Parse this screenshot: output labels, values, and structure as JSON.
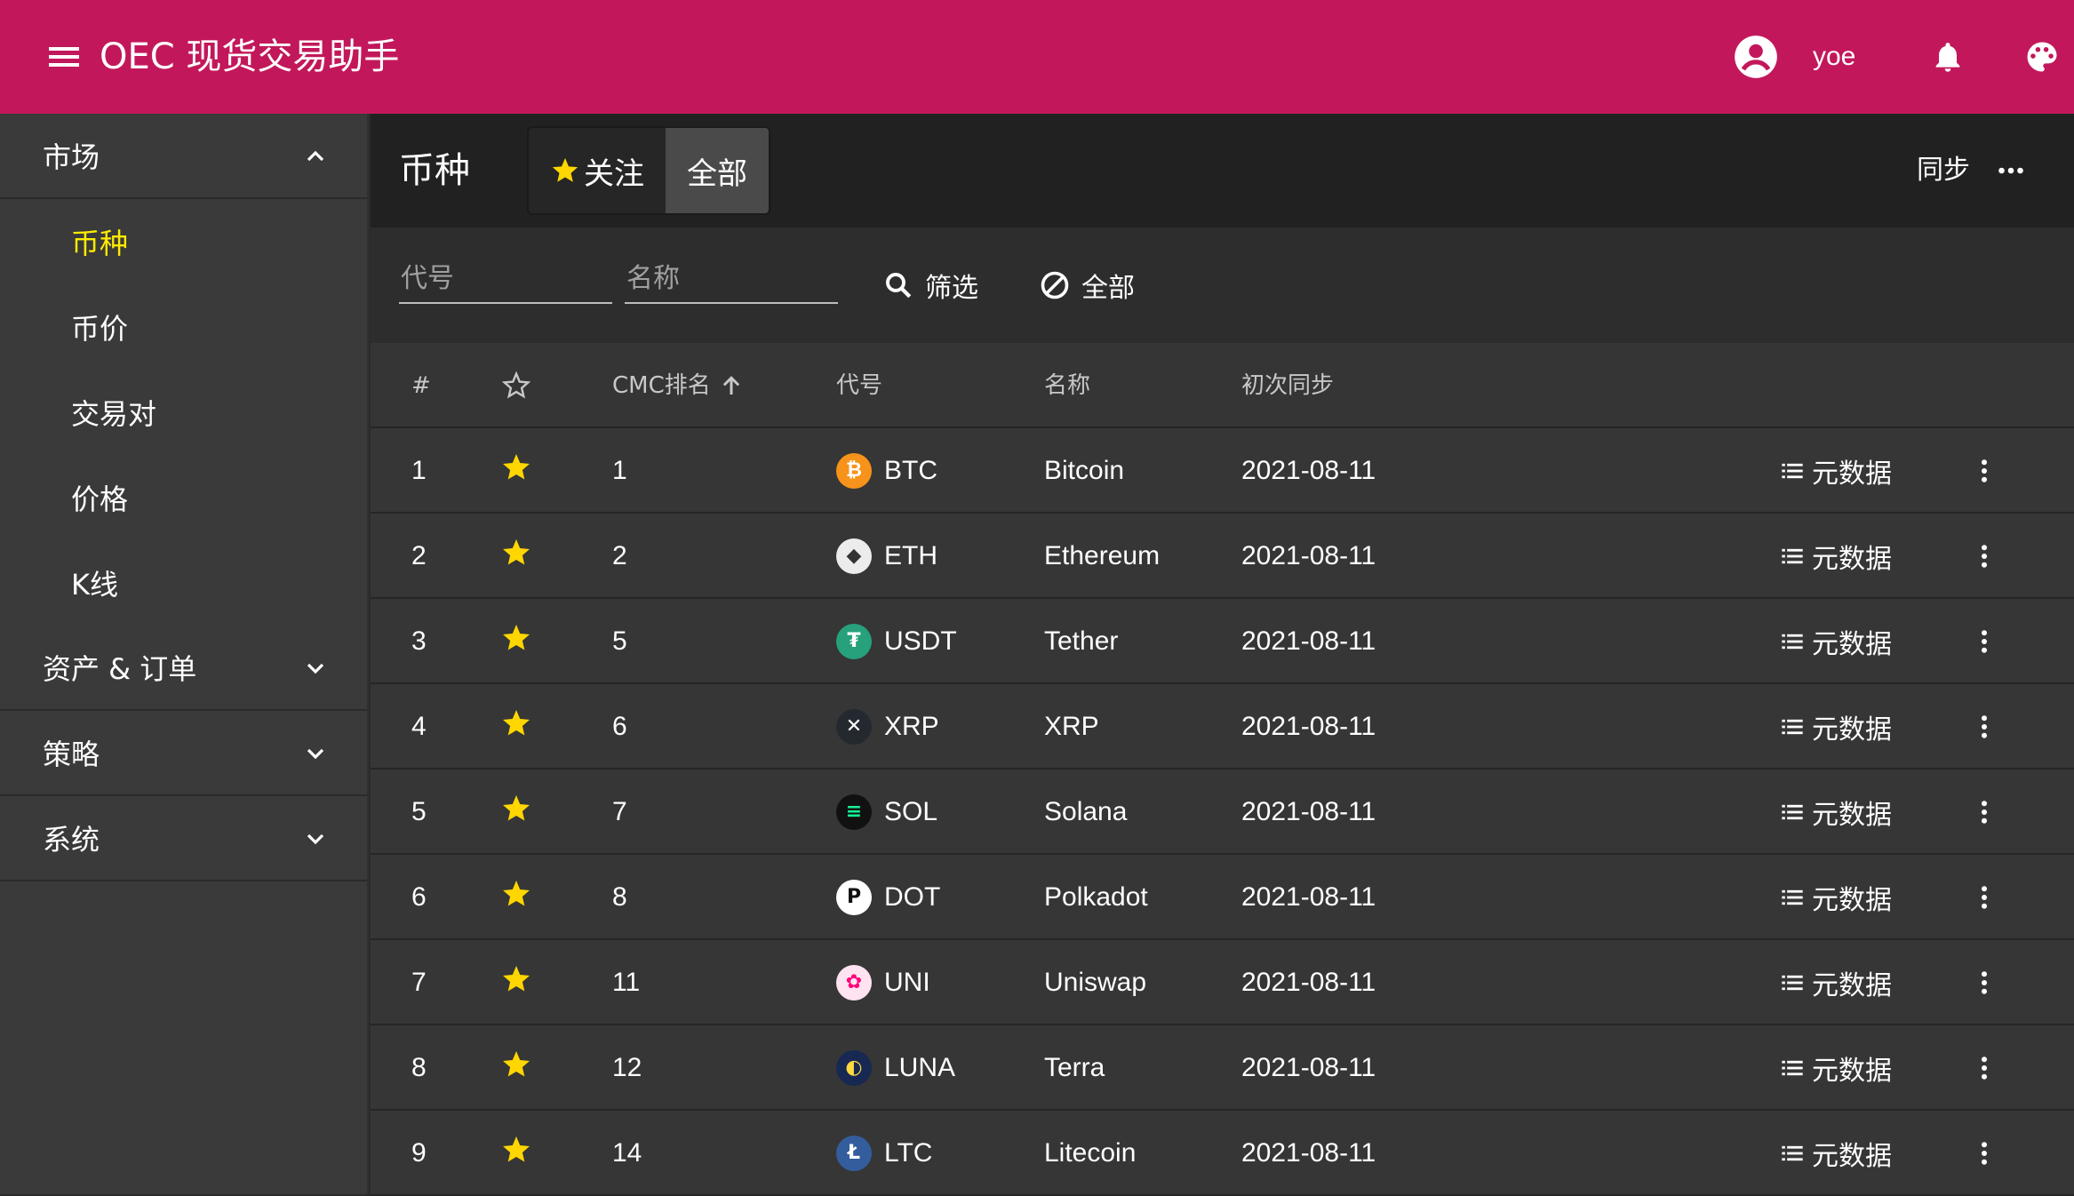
{
  "app": {
    "title": "OEC 现货交易助手",
    "username": "yoe",
    "colors": {
      "appbar": "#c2185b",
      "active_nav": "#ffeb00",
      "star": "#ffd600"
    }
  },
  "sidebar": {
    "groups": [
      {
        "label": "市场",
        "expanded": true,
        "items": [
          {
            "label": "币种",
            "active": true
          },
          {
            "label": "币价"
          },
          {
            "label": "交易对"
          },
          {
            "label": "价格"
          },
          {
            "label": "K线"
          }
        ]
      },
      {
        "label": "资产 & 订单",
        "expanded": false
      },
      {
        "label": "策略",
        "expanded": false
      },
      {
        "label": "系统",
        "expanded": false
      }
    ]
  },
  "toolbar": {
    "title": "币种",
    "toggle_follow": "关注",
    "toggle_all": "全部",
    "sync": "同步"
  },
  "filters": {
    "code_placeholder": "代号",
    "name_placeholder": "名称",
    "filter_label": "筛选",
    "all_label": "全部"
  },
  "table": {
    "headers": {
      "index": "#",
      "cmc_rank": "CMC排名",
      "code": "代号",
      "name": "名称",
      "first_sync": "初次同步"
    },
    "meta_label": "元数据",
    "rows": [
      {
        "index": "1",
        "rank": "1",
        "code": "BTC",
        "name": "Bitcoin",
        "date": "2021-08-11",
        "icon": "btc-icon"
      },
      {
        "index": "2",
        "rank": "2",
        "code": "ETH",
        "name": "Ethereum",
        "date": "2021-08-11",
        "icon": "eth-icon"
      },
      {
        "index": "3",
        "rank": "5",
        "code": "USDT",
        "name": "Tether",
        "date": "2021-08-11",
        "icon": "usdt-icon"
      },
      {
        "index": "4",
        "rank": "6",
        "code": "XRP",
        "name": "XRP",
        "date": "2021-08-11",
        "icon": "xrp-icon"
      },
      {
        "index": "5",
        "rank": "7",
        "code": "SOL",
        "name": "Solana",
        "date": "2021-08-11",
        "icon": "sol-icon"
      },
      {
        "index": "6",
        "rank": "8",
        "code": "DOT",
        "name": "Polkadot",
        "date": "2021-08-11",
        "icon": "dot-icon"
      },
      {
        "index": "7",
        "rank": "11",
        "code": "UNI",
        "name": "Uniswap",
        "date": "2021-08-11",
        "icon": "uni-icon"
      },
      {
        "index": "8",
        "rank": "12",
        "code": "LUNA",
        "name": "Terra",
        "date": "2021-08-11",
        "icon": "luna-icon"
      },
      {
        "index": "9",
        "rank": "14",
        "code": "LTC",
        "name": "Litecoin",
        "date": "2021-08-11",
        "icon": "ltc-icon"
      }
    ]
  }
}
